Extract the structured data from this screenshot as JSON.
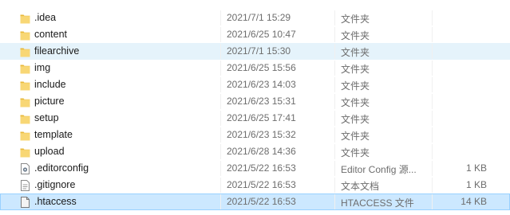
{
  "files": [
    {
      "name": ".idea",
      "date": "2021/7/1 15:29",
      "type": "文件夹",
      "size": "",
      "icon": "folder-icon",
      "state": ""
    },
    {
      "name": "content",
      "date": "2021/6/25 10:47",
      "type": "文件夹",
      "size": "",
      "icon": "folder-icon",
      "state": ""
    },
    {
      "name": "filearchive",
      "date": "2021/7/1 15:30",
      "type": "文件夹",
      "size": "",
      "icon": "folder-icon",
      "state": "hover"
    },
    {
      "name": "img",
      "date": "2021/6/25 15:56",
      "type": "文件夹",
      "size": "",
      "icon": "folder-icon",
      "state": ""
    },
    {
      "name": "include",
      "date": "2021/6/23 14:03",
      "type": "文件夹",
      "size": "",
      "icon": "folder-icon",
      "state": ""
    },
    {
      "name": "picture",
      "date": "2021/6/23 15:31",
      "type": "文件夹",
      "size": "",
      "icon": "folder-icon",
      "state": ""
    },
    {
      "name": "setup",
      "date": "2021/6/25 17:41",
      "type": "文件夹",
      "size": "",
      "icon": "folder-icon",
      "state": ""
    },
    {
      "name": "template",
      "date": "2021/6/23 15:32",
      "type": "文件夹",
      "size": "",
      "icon": "folder-icon",
      "state": ""
    },
    {
      "name": "upload",
      "date": "2021/6/28 14:36",
      "type": "文件夹",
      "size": "",
      "icon": "folder-icon",
      "state": ""
    },
    {
      "name": ".editorconfig",
      "date": "2021/5/22 16:53",
      "type": "Editor Config 源...",
      "size": "1 KB",
      "icon": "settings-file-icon",
      "state": ""
    },
    {
      "name": ".gitignore",
      "date": "2021/5/22 16:53",
      "type": "文本文档",
      "size": "1 KB",
      "icon": "text-file-icon",
      "state": ""
    },
    {
      "name": ".htaccess",
      "date": "2021/5/22 16:53",
      "type": "HTACCESS 文件",
      "size": "14 KB",
      "icon": "generic-file-icon",
      "state": "selected"
    }
  ],
  "colors": {
    "folder": "#f8d775",
    "folder_dark": "#e8b93c",
    "hover": "#e5f3fb",
    "selected": "#cce8ff",
    "selected_border": "#99d1ff"
  }
}
